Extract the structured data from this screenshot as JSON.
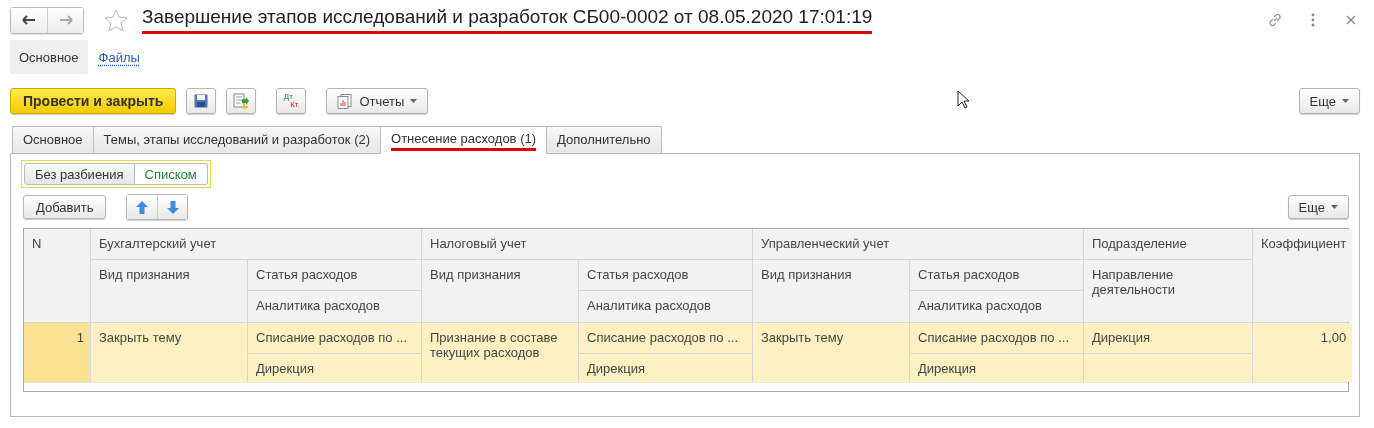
{
  "window": {
    "title": "Завершение этапов исследований и разработок СБ00-0002 от 08.05.2020 17:01:19",
    "title_underlined": true
  },
  "nav_tabs": [
    {
      "label": "Основное",
      "selected": true
    },
    {
      "label": "Файлы",
      "selected": false
    }
  ],
  "toolbar": {
    "primary": "Провести и закрыть",
    "reports": "Отчеты",
    "dtkt_top": "Дт",
    "dtkt_bottom": "Кт",
    "more": "Еще"
  },
  "tabs": [
    {
      "label": "Основное",
      "selected": false,
      "underlined": false
    },
    {
      "label": "Темы, этапы исследований и разработок (2)",
      "selected": false,
      "underlined": false
    },
    {
      "label": "Отнесение расходов (1)",
      "selected": true,
      "underlined": true
    },
    {
      "label": "Дополнительно",
      "selected": false,
      "underlined": false
    }
  ],
  "view_switch": [
    {
      "label": "Без разбиения",
      "selected": false
    },
    {
      "label": "Списком",
      "selected": true
    }
  ],
  "table_toolbar": {
    "add": "Добавить",
    "more": "Еще"
  },
  "table": {
    "columns": {
      "n": "N",
      "groups": [
        {
          "title": "Бухгалтерский учет",
          "recognition": "Вид признания",
          "expense_item": "Статья расходов",
          "analytics": "Аналитика расходов"
        },
        {
          "title": "Налоговый учет",
          "recognition": "Вид признания",
          "expense_item": "Статья расходов",
          "analytics": "Аналитика расходов"
        },
        {
          "title": "Управленческий учет",
          "recognition": "Вид признания",
          "expense_item": "Статья расходов",
          "analytics": "Аналитика расходов"
        }
      ],
      "department": "Подразделение",
      "direction": "Направление деятельности",
      "coefficient": "Коэффициент"
    },
    "rows": [
      {
        "n": "1",
        "selected": true,
        "sections": [
          {
            "recognition": "Закрыть тему",
            "expense_item": "Списание расходов по ...",
            "analytics": "Дирекция"
          },
          {
            "recognition": "Признание в составе текущих расходов",
            "expense_item": "Списание расходов по ...",
            "analytics": "Дирекция"
          },
          {
            "recognition": "Закрыть тему",
            "expense_item": "Списание расходов по ...",
            "analytics": "Дирекция"
          }
        ],
        "department": "Дирекция",
        "coefficient": "1,00"
      }
    ]
  }
}
